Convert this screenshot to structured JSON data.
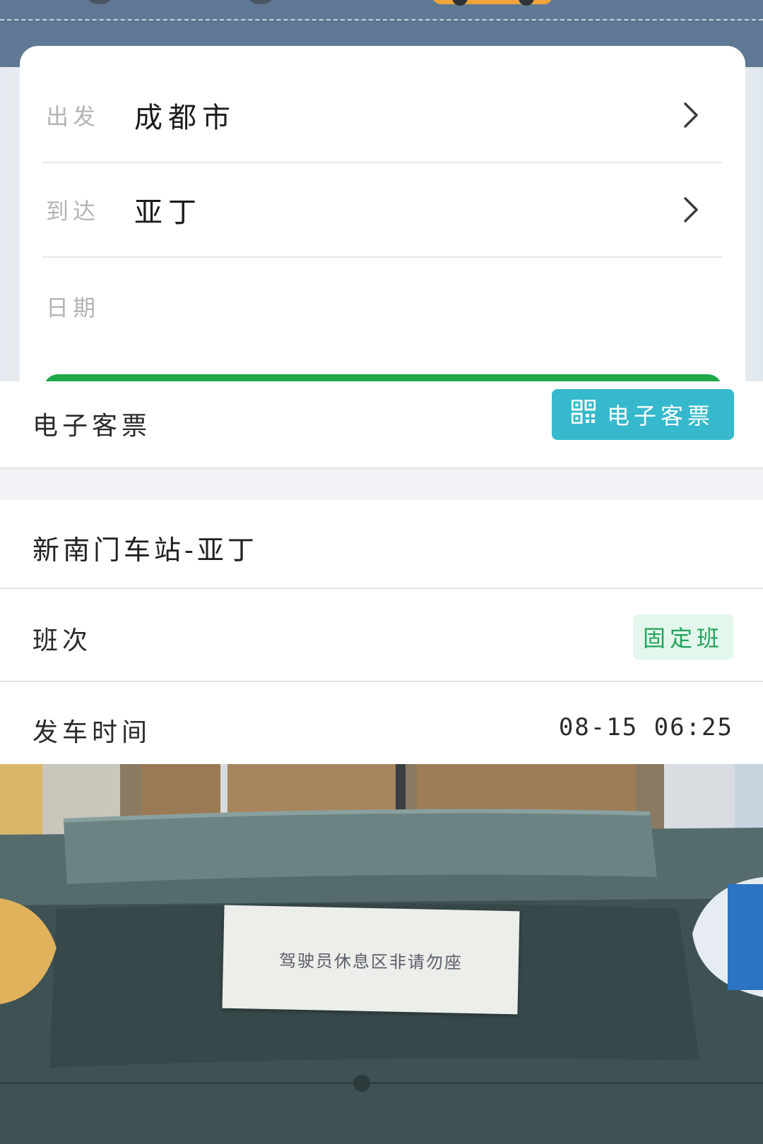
{
  "search_form": {
    "departure_label": "出发",
    "departure_value": "成都市",
    "arrival_label": "到达",
    "arrival_value": "亚丁",
    "date_label": "日期",
    "date_value": ""
  },
  "ticket": {
    "section_title": "电子客票",
    "button_label": "电子客票"
  },
  "trip": {
    "route": "新南门车站-亚丁",
    "schedule_label": "班次",
    "schedule_type": "固定班",
    "departure_time_label": "发车时间",
    "departure_time": "08-15 06:25"
  },
  "photo": {
    "note_text": "驾驶员休息区非请勿座"
  },
  "colors": {
    "header_band": "#5f7994",
    "search_button_green": "#1ea84a",
    "eticket_button": "#36b9cc",
    "fixed_badge_bg": "#e3f7ec",
    "fixed_badge_text": "#23a35a"
  },
  "icons": {
    "chevron": "chevron-right-icon",
    "qr": "qr-code-icon"
  }
}
